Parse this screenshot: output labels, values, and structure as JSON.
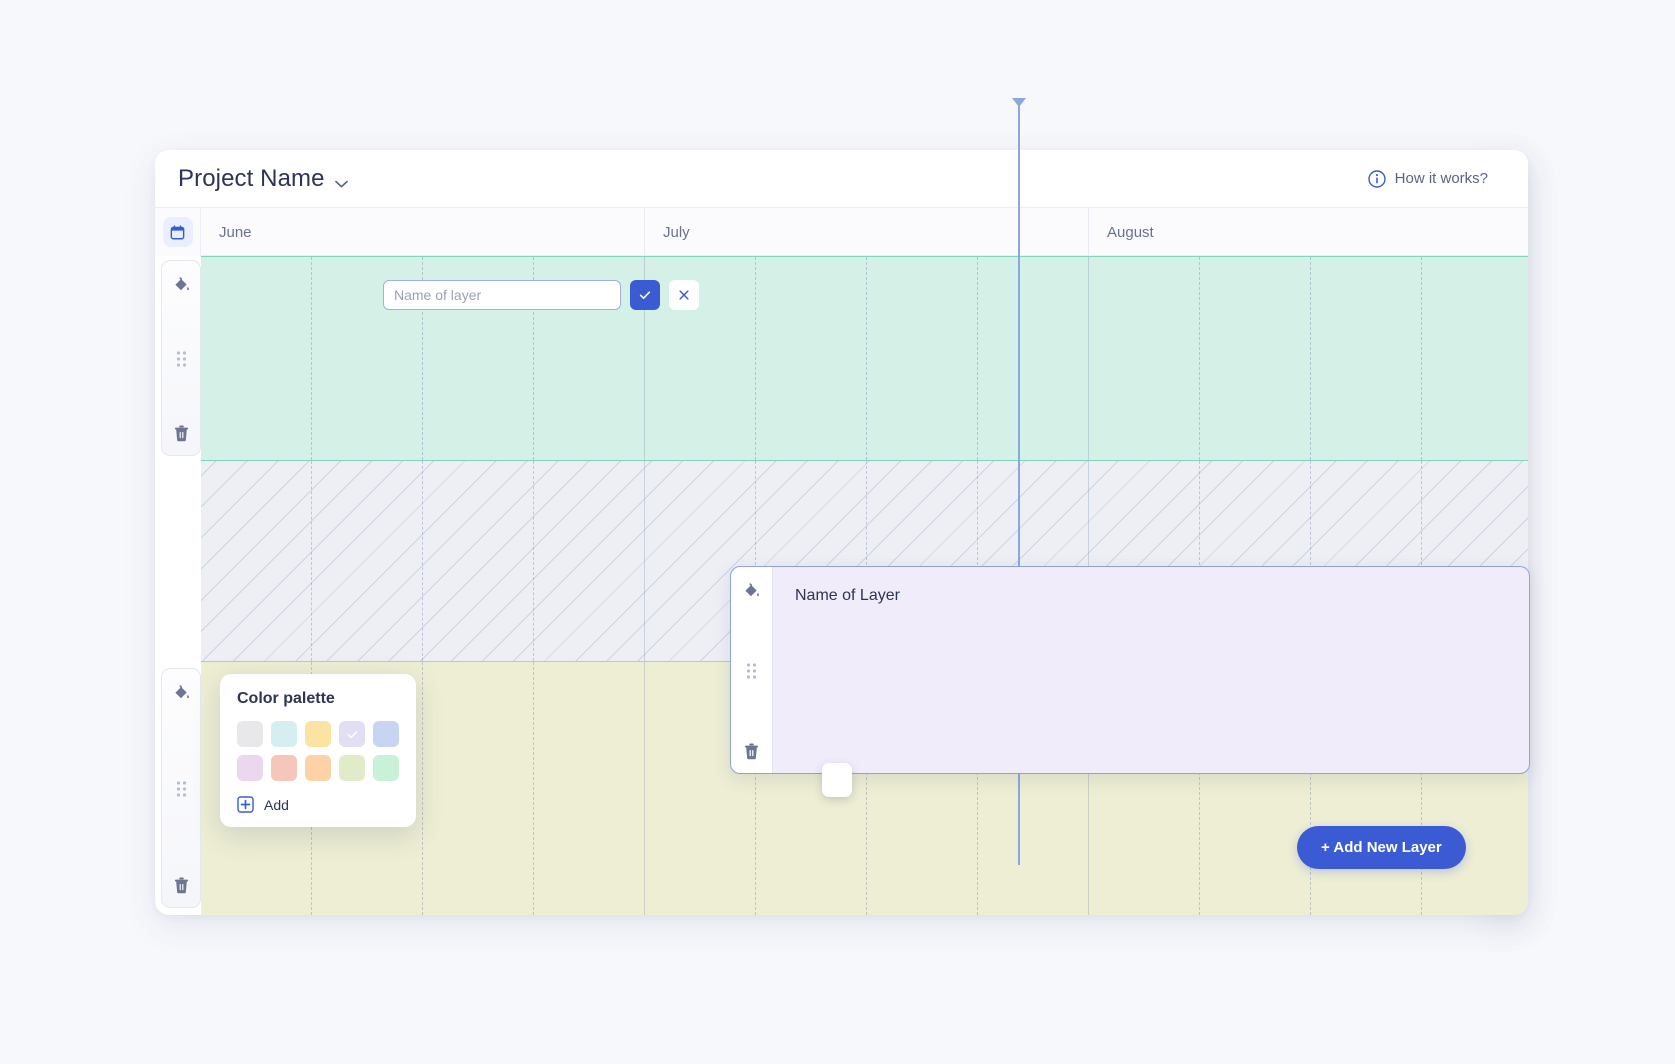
{
  "header": {
    "project_title": "Project Name",
    "chevron_icon": "chevron-down-icon",
    "how_it_works": "How it works?",
    "info_icon": "info-circle-icon"
  },
  "rail": {
    "logo_icon": "diamond-logo-icon"
  },
  "timeline": {
    "calendar_icon": "calendar-icon",
    "months": [
      "June",
      "July",
      "August"
    ],
    "today_marker": "today-line"
  },
  "row_controls": {
    "fill_icon": "paint-bucket-icon",
    "drag_icon": "drag-handle-icon",
    "delete_icon": "trash-icon"
  },
  "layer_editor": {
    "placeholder": "Name of layer",
    "value": "",
    "confirm_icon": "check-icon",
    "cancel_icon": "close-icon"
  },
  "layer_card": {
    "title": "Name of Layer",
    "fill_icon": "paint-bucket-icon",
    "drag_icon": "drag-handle-icon",
    "delete_icon": "trash-icon",
    "resize_handle": "resize-handle"
  },
  "palette": {
    "title": "Color palette",
    "add_label": "Add",
    "add_icon": "plus-square-icon",
    "selected_index": 3,
    "swatches": [
      {
        "name": "gray",
        "hex": "#e8e8ea"
      },
      {
        "name": "light-cyan",
        "hex": "#d5eff0"
      },
      {
        "name": "yellow",
        "hex": "#fbe3a2"
      },
      {
        "name": "lavender",
        "hex": "#e2dff4"
      },
      {
        "name": "periwinkle",
        "hex": "#c8d5f2"
      },
      {
        "name": "light-purple",
        "hex": "#ecd8ee"
      },
      {
        "name": "salmon",
        "hex": "#f7c6ba"
      },
      {
        "name": "peach",
        "hex": "#fdd2a4"
      },
      {
        "name": "light-green",
        "hex": "#e0ecc8"
      },
      {
        "name": "mint",
        "hex": "#c9f0d9"
      }
    ]
  },
  "actions": {
    "add_new_layer": "+ Add New Layer"
  },
  "colors": {
    "accent": "#3b5bd4",
    "row_teal": "#d5f0e7",
    "row_hatch": "#edeff5",
    "row_yellow": "#eeeed4",
    "layer_card": "#f0ecfa"
  }
}
